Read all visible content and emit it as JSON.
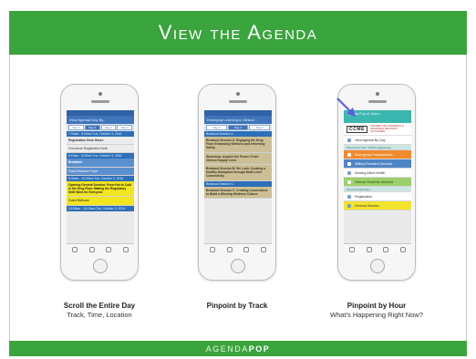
{
  "header": {
    "title": "View the Agenda"
  },
  "footer": {
    "brand_light": "AGENDA",
    "brand_bold": "POP"
  },
  "phone1": {
    "nav_title": "View Agenda Day By...",
    "segments": [
      "Day 1",
      "Day 2",
      "Day 3",
      "Day 4"
    ],
    "rows": [
      {
        "kind": "hdr",
        "text": "7:00am - 8:00am Tue, October 3, 2016"
      },
      {
        "kind": "cell",
        "style": "bold",
        "text": "Registration Desk Hours"
      },
      {
        "kind": "cell",
        "style": "",
        "text": "Concourse Registration Desk"
      },
      {
        "kind": "hdr",
        "text": "8:15am - 8:30am Tue, October 3, 2016"
      },
      {
        "kind": "cell",
        "style": "blue bold",
        "text": "Breakfast"
      },
      {
        "kind": "cell",
        "style": "blue",
        "text": "Grand Ballroom Foyer"
      },
      {
        "kind": "hdr",
        "text": "8:30am - 10:00am Tue, October 3, 2016"
      },
      {
        "kind": "cell",
        "style": "yellow bold",
        "text": "Opening General Session: From Hot to Cold in the Drug Flow: Making the Regulatory Shift Work for Everyone"
      },
      {
        "kind": "cell",
        "style": "yellow",
        "text": "Grand Ballroom"
      },
      {
        "kind": "hdr",
        "text": "10:00am - 10:15am Tue, October 3, 2016"
      }
    ]
  },
  "phone2": {
    "nav_title": "Emerging Learning & Clinical...",
    "segments": [
      "Day 1",
      "Day 2",
      "Day 3"
    ],
    "rows": [
      {
        "kind": "hdr",
        "text": "Breakout Session A"
      },
      {
        "kind": "cell",
        "style": "tan bold",
        "text": "Breakout Session A: Engaging the Drug Flow: Enhancing Wellness and Informing Safety"
      },
      {
        "kind": "cell",
        "style": "tan bold",
        "text": "Workshop: Acquire the Power. Fresh Clinical Supply Lines"
      },
      {
        "kind": "cell",
        "style": "tan bold",
        "text": "Breakout Session B: We Look: Creating a Healthy Workplace through Multi-Level Connectivity"
      },
      {
        "kind": "hdr",
        "text": "Breakout Session C"
      },
      {
        "kind": "cell",
        "style": "tan bold",
        "text": "Breakout Session C: Creating Connections to Build a Winning Wellness Culture"
      }
    ]
  },
  "phone3": {
    "top_text": "Agenda Pop at 10am...",
    "logo": "CCME",
    "logo_text": "CONNECTING EVIDENCE & MANAGING DECISION OUTCOMES",
    "menu": [
      {
        "style": "",
        "text": "View Agenda By Day"
      },
      {
        "style": "sect",
        "text": "Pinpoint by Hour: What's Happening"
      },
      {
        "style": "ora",
        "text": "Emergency Preparedness"
      },
      {
        "style": "blu",
        "text": "Military Resident Services"
      },
      {
        "style": "",
        "text": "Nursing Allied Health"
      },
      {
        "style": "grn",
        "text": "Veteran Students Services"
      },
      {
        "style": "sect",
        "text": "General Information"
      },
      {
        "style": "",
        "text": "Registration"
      },
      {
        "style": "yel",
        "text": "General Session"
      }
    ]
  },
  "captions": [
    {
      "title": "Scroll the Entire Day",
      "sub": "Track, Time, Location"
    },
    {
      "title": "Pinpoint by Track",
      "sub": ""
    },
    {
      "title": "Pinpoint by Hour",
      "sub": "What's Happening Right Now?"
    }
  ],
  "colors": {
    "green": "#3aa43d",
    "arrow": "#5a5ee0"
  }
}
